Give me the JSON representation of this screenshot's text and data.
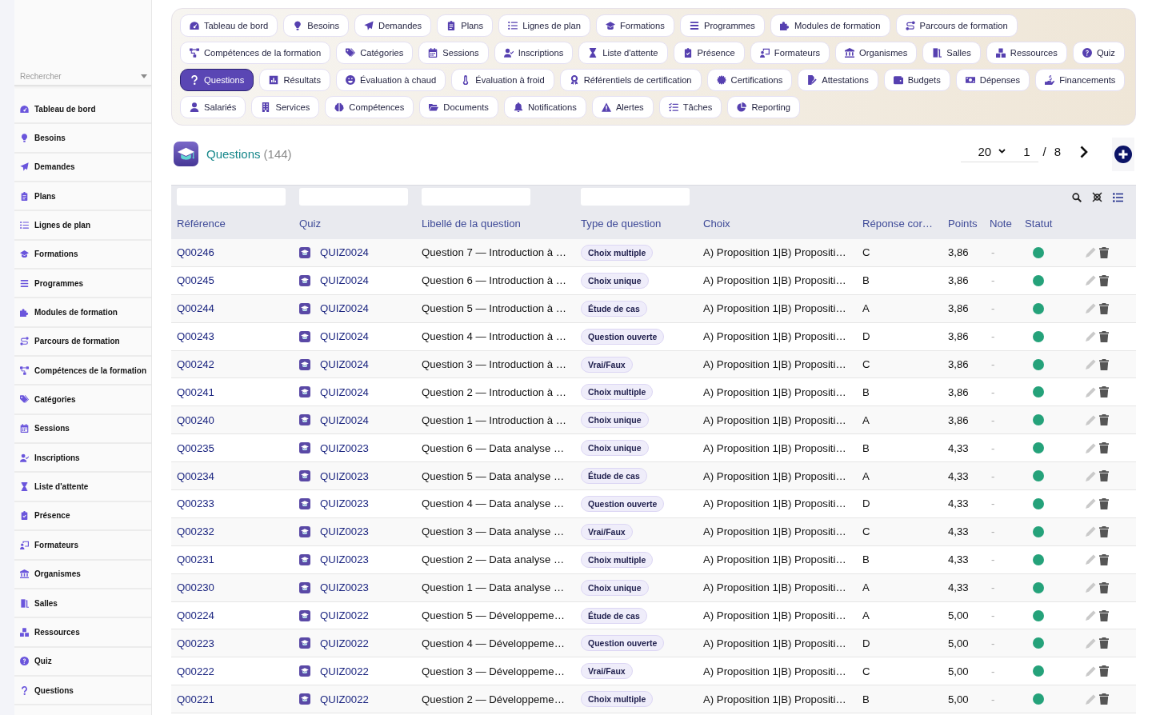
{
  "sidebar": {
    "search": {
      "placeholder": "Rechercher"
    },
    "items": [
      "Tableau de bord",
      "Besoins",
      "Demandes",
      "Plans",
      "Lignes de plan",
      "Formations",
      "Programmes",
      "Modules de formation",
      "Parcours de formation",
      "Compétences de la formation",
      "Catégories",
      "Sessions",
      "Inscriptions",
      "Liste d'attente",
      "Présence",
      "Formateurs",
      "Organismes",
      "Salles",
      "Ressources",
      "Quiz",
      "Questions"
    ]
  },
  "nav": {
    "items": [
      {
        "label": "Tableau de bord",
        "selected": false
      },
      {
        "label": "Besoins",
        "selected": false
      },
      {
        "label": "Demandes",
        "selected": false
      },
      {
        "label": "Plans",
        "selected": false
      },
      {
        "label": "Lignes de plan",
        "selected": false
      },
      {
        "label": "Formations",
        "selected": false
      },
      {
        "label": "Programmes",
        "selected": false
      },
      {
        "label": "Modules de formation",
        "selected": false
      },
      {
        "label": "Parcours de formation",
        "selected": false
      },
      {
        "label": "Compétences de la formation",
        "selected": false
      },
      {
        "label": "Catégories",
        "selected": false
      },
      {
        "label": "Sessions",
        "selected": false
      },
      {
        "label": "Inscriptions",
        "selected": false
      },
      {
        "label": "Liste d'attente",
        "selected": false
      },
      {
        "label": "Présence",
        "selected": false
      },
      {
        "label": "Formateurs",
        "selected": false
      },
      {
        "label": "Organismes",
        "selected": false
      },
      {
        "label": "Salles",
        "selected": false
      },
      {
        "label": "Ressources",
        "selected": false
      },
      {
        "label": "Quiz",
        "selected": false
      },
      {
        "label": "Questions",
        "selected": true
      },
      {
        "label": "Résultats",
        "selected": false
      },
      {
        "label": "Évaluation à chaud",
        "selected": false
      },
      {
        "label": "Évaluation à froid",
        "selected": false
      },
      {
        "label": "Référentiels de certification",
        "selected": false
      },
      {
        "label": "Certifications",
        "selected": false
      },
      {
        "label": "Attestations",
        "selected": false
      },
      {
        "label": "Budgets",
        "selected": false
      },
      {
        "label": "Dépenses",
        "selected": false
      },
      {
        "label": "Financements",
        "selected": false
      },
      {
        "label": "Salariés",
        "selected": false
      },
      {
        "label": "Services",
        "selected": false
      },
      {
        "label": "Compétences",
        "selected": false
      },
      {
        "label": "Documents",
        "selected": false
      },
      {
        "label": "Notifications",
        "selected": false
      },
      {
        "label": "Alertes",
        "selected": false
      },
      {
        "label": "Tâches",
        "selected": false
      },
      {
        "label": "Reporting",
        "selected": false
      }
    ]
  },
  "header": {
    "title": "Questions",
    "count": "(144)",
    "page_size": "20",
    "page": "1",
    "page_separator": "/",
    "page_count": "8"
  },
  "table": {
    "columns": [
      {
        "label": "Référence",
        "filter": true
      },
      {
        "label": "Quiz",
        "filter": true
      },
      {
        "label": "Libellé de la question",
        "filter": true
      },
      {
        "label": "Type de question",
        "filter": true
      },
      {
        "label": "Choix",
        "filter": false
      },
      {
        "label": "Réponse cor…",
        "filter": false
      },
      {
        "label": "Points",
        "filter": false
      },
      {
        "label": "Note",
        "filter": false
      },
      {
        "label": "Statut",
        "filter": false
      }
    ],
    "rows": [
      {
        "reference": "Q00246",
        "quiz": "QUIZ0024",
        "question": "Question 7 — Introduction à …",
        "type": "Choix multiple",
        "choices": "A) Proposition 1|B) Propositi…",
        "answer": "C",
        "points": "3,86",
        "note": "-",
        "color": "#25a27a"
      },
      {
        "reference": "Q00245",
        "quiz": "QUIZ0024",
        "question": "Question 6 — Introduction à …",
        "type": "Choix unique",
        "choices": "A) Proposition 1|B) Propositi…",
        "answer": "B",
        "points": "3,86",
        "note": "-",
        "color": "#25a27a"
      },
      {
        "reference": "Q00244",
        "quiz": "QUIZ0024",
        "question": "Question 5 — Introduction à …",
        "type": "Étude de cas",
        "choices": "A) Proposition 1|B) Propositi…",
        "answer": "A",
        "points": "3,86",
        "note": "-",
        "color": "#25a27a"
      },
      {
        "reference": "Q00243",
        "quiz": "QUIZ0024",
        "question": "Question 4 — Introduction à …",
        "type": "Question ouverte",
        "choices": "A) Proposition 1|B) Propositi…",
        "answer": "D",
        "points": "3,86",
        "note": "-",
        "color": "#25a27a"
      },
      {
        "reference": "Q00242",
        "quiz": "QUIZ0024",
        "question": "Question 3 — Introduction à …",
        "type": "Vrai/Faux",
        "choices": "A) Proposition 1|B) Propositi…",
        "answer": "C",
        "points": "3,86",
        "note": "-",
        "color": "#25a27a"
      },
      {
        "reference": "Q00241",
        "quiz": "QUIZ0024",
        "question": "Question 2 — Introduction à …",
        "type": "Choix multiple",
        "choices": "A) Proposition 1|B) Propositi…",
        "answer": "B",
        "points": "3,86",
        "note": "-",
        "color": "#25a27a"
      },
      {
        "reference": "Q00240",
        "quiz": "QUIZ0024",
        "question": "Question 1 — Introduction à …",
        "type": "Choix unique",
        "choices": "A) Proposition 1|B) Propositi…",
        "answer": "A",
        "points": "3,86",
        "note": "-",
        "color": "#25a27a"
      },
      {
        "reference": "Q00235",
        "quiz": "QUIZ0023",
        "question": "Question 6 — Data analyse …",
        "type": "Choix unique",
        "choices": "A) Proposition 1|B) Propositi…",
        "answer": "B",
        "points": "4,33",
        "note": "-",
        "color": "#25a27a"
      },
      {
        "reference": "Q00234",
        "quiz": "QUIZ0023",
        "question": "Question 5 — Data analyse …",
        "type": "Étude de cas",
        "choices": "A) Proposition 1|B) Propositi…",
        "answer": "A",
        "points": "4,33",
        "note": "-",
        "color": "#25a27a"
      },
      {
        "reference": "Q00233",
        "quiz": "QUIZ0023",
        "question": "Question 4 — Data analyse …",
        "type": "Question ouverte",
        "choices": "A) Proposition 1|B) Propositi…",
        "answer": "D",
        "points": "4,33",
        "note": "-",
        "color": "#25a27a"
      },
      {
        "reference": "Q00232",
        "quiz": "QUIZ0023",
        "question": "Question 3 — Data analyse …",
        "type": "Vrai/Faux",
        "choices": "A) Proposition 1|B) Propositi…",
        "answer": "C",
        "points": "4,33",
        "note": "-",
        "color": "#25a27a"
      },
      {
        "reference": "Q00231",
        "quiz": "QUIZ0023",
        "question": "Question 2 — Data analyse …",
        "type": "Choix multiple",
        "choices": "A) Proposition 1|B) Propositi…",
        "answer": "B",
        "points": "4,33",
        "note": "-",
        "color": "#25a27a"
      },
      {
        "reference": "Q00230",
        "quiz": "QUIZ0023",
        "question": "Question 1 — Data analyse …",
        "type": "Choix unique",
        "choices": "A) Proposition 1|B) Propositi…",
        "answer": "A",
        "points": "4,33",
        "note": "-",
        "color": "#25a27a"
      },
      {
        "reference": "Q00224",
        "quiz": "QUIZ0022",
        "question": "Question 5 — Développeme…",
        "type": "Étude de cas",
        "choices": "A) Proposition 1|B) Propositi…",
        "answer": "A",
        "points": "5,00",
        "note": "-",
        "color": "#25a27a"
      },
      {
        "reference": "Q00223",
        "quiz": "QUIZ0022",
        "question": "Question 4 — Développeme…",
        "type": "Question ouverte",
        "choices": "A) Proposition 1|B) Propositi…",
        "answer": "D",
        "points": "5,00",
        "note": "-",
        "color": "#25a27a"
      },
      {
        "reference": "Q00222",
        "quiz": "QUIZ0022",
        "question": "Question 3 — Développeme…",
        "type": "Vrai/Faux",
        "choices": "A) Proposition 1|B) Propositi…",
        "answer": "C",
        "points": "5,00",
        "note": "-",
        "color": "#25a27a"
      },
      {
        "reference": "Q00221",
        "quiz": "QUIZ0022",
        "question": "Question 2 — Développeme…",
        "type": "Choix multiple",
        "choices": "A) Proposition 1|B) Propositi…",
        "answer": "B",
        "points": "5,00",
        "note": "-",
        "color": "#25a27a"
      }
    ]
  }
}
